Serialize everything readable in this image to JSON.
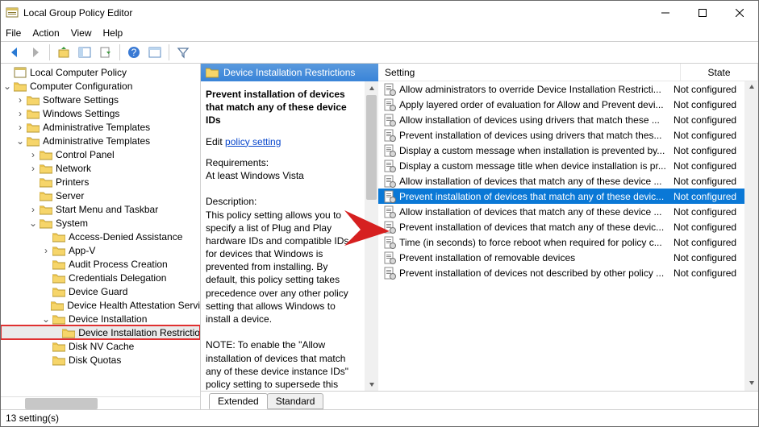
{
  "window": {
    "title": "Local Group Policy Editor"
  },
  "menubar": [
    "File",
    "Action",
    "View",
    "Help"
  ],
  "tree": {
    "root": "Local Computer Policy",
    "cc": "Computer Configuration",
    "soft": "Software Settings",
    "win": "Windows Settings",
    "admin1": "Administrative Templates",
    "admin2": "Administrative Templates",
    "cp": "Control Panel",
    "net": "Network",
    "prn": "Printers",
    "srv": "Server",
    "smt": "Start Menu and Taskbar",
    "sys": "System",
    "ada": "Access-Denied Assistance",
    "appv": "App-V",
    "apc": "Audit Process Creation",
    "cred": "Credentials Delegation",
    "dg": "Device Guard",
    "dhas": "Device Health Attestation Servi",
    "di": "Device Installation",
    "dir": "Device Installation Restrictio",
    "dnv": "Disk NV Cache",
    "dq": "Disk Quotas"
  },
  "details": {
    "header": "Device Installation Restrictions",
    "title": "Prevent installation of devices that match any of these device IDs",
    "edit_prefix": "Edit",
    "edit_link": "policy setting",
    "req_label": "Requirements:",
    "req_value": "At least Windows Vista",
    "desc_label": "Description:",
    "desc_p1": "This policy setting allows you to specify a list of Plug and Play hardware IDs and compatible IDs for devices that Windows is prevented from installing. By default, this policy setting takes precedence over any other policy setting that allows Windows to install a device.",
    "desc_p2": "NOTE: To enable the \"Allow installation of devices that match any of these device instance IDs\" policy setting to supersede this policy setting for applicable"
  },
  "list": {
    "col_setting": "Setting",
    "col_state": "State",
    "state_nc": "Not configured",
    "items": [
      "Allow administrators to override Device Installation Restricti...",
      "Apply layered order of evaluation for Allow and Prevent devi...",
      "Allow installation of devices using drivers that match these ...",
      "Prevent installation of devices using drivers that match thes...",
      "Display a custom message when installation is prevented by...",
      "Display a custom message title when device installation is pr...",
      "Allow installation of devices that match any of these device ...",
      "Prevent installation of devices that match any of these devic...",
      "Allow installation of devices that match any of these device ...",
      "Prevent installation of devices that match any of these devic...",
      "Time (in seconds) to force reboot when required for policy c...",
      "Prevent installation of removable devices",
      "Prevent installation of devices not described by other policy ..."
    ],
    "selected_index": 7
  },
  "tabs": {
    "extended": "Extended",
    "standard": "Standard"
  },
  "status": "13 setting(s)"
}
